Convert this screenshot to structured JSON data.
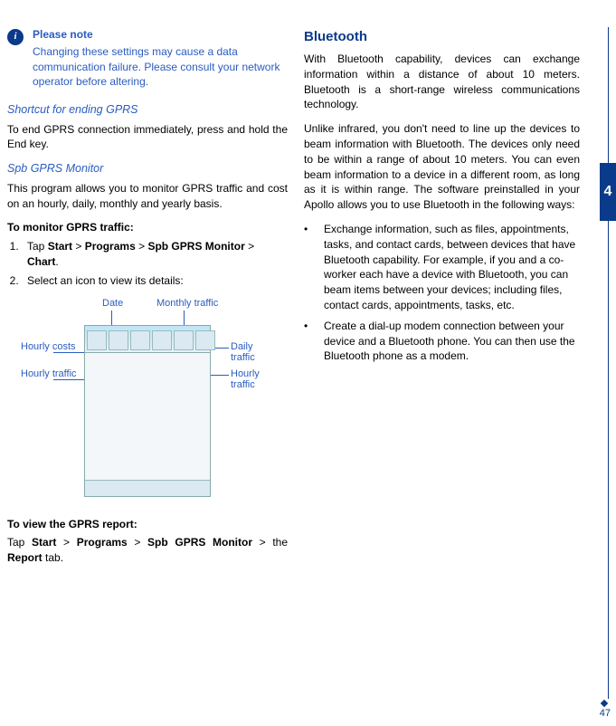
{
  "note": {
    "title": "Please note",
    "body": "Changing these settings may cause a data communication failure. Please consult your network operator before altering."
  },
  "left": {
    "shortcut_head": "Shortcut for ending GPRS",
    "shortcut_body": "To end GPRS connection immediately, press and hold the End key.",
    "spb_head": "Spb GPRS Monitor",
    "spb_body": "This program allows you to monitor GPRS traffic and cost on an hourly, daily, monthly and yearly basis.",
    "monitor_head": "To monitor GPRS traffic:",
    "step1_pre": "Tap ",
    "step1_b1": "Start",
    "step1_gt1": " > ",
    "step1_b2": "Programs",
    "step1_gt2": " > ",
    "step1_b3": "Spb GPRS Monitor",
    "step1_gt3": " > ",
    "step1_b4": "Chart",
    "step1_dot": ".",
    "step2": "Select an icon to view its details:",
    "report_head": "To view the GPRS report:",
    "report_pre": "Tap ",
    "report_b1": "Start",
    "report_gt1": " > ",
    "report_b2": "Programs",
    "report_gt2": " > ",
    "report_b3": "Spb GPRS Monitor",
    "report_gt3": " > the ",
    "report_b4": "Report",
    "report_tail": " tab."
  },
  "diagram": {
    "date": "Date",
    "monthly": "Monthly traffic",
    "hourly_costs": "Hourly costs",
    "hourly_traffic_l": "Hourly traffic",
    "daily": "Daily traffic",
    "hourly_traffic_r": "Hourly traffic"
  },
  "right": {
    "heading": "Bluetooth",
    "p1": "With Bluetooth capability, devices can exchange information within a distance of about 10 meters. Bluetooth is a short-range wireless communications technology.",
    "p2": "Unlike infrared, you don't need to line up the devices to beam information with Bluetooth. The devices only need to be within a range of about 10 meters. You can even beam information to a device in a different room, as long as it is within range. The software preinstalled in your Apollo allows you to use Bluetooth in the following ways:",
    "bul1": "Exchange information, such as files, appointments, tasks, and contact cards, between devices that have Bluetooth capability. For example, if you and a co-worker each have a device with Bluetooth, you can beam items between your devices; including files, contact cards, appointments, tasks, etc.",
    "bul2": "Create a dial-up modem connection between your device and a Bluetooth phone. You can then use the Bluetooth phone as a modem."
  },
  "side": {
    "chapter": "4"
  },
  "footer": {
    "page": "47"
  },
  "bullet": "•"
}
